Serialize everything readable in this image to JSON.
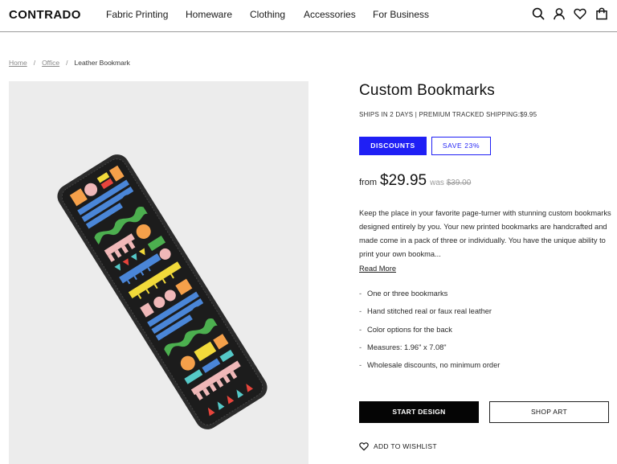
{
  "header": {
    "logo": "CONTRADO",
    "nav": [
      "Fabric Printing",
      "Homeware",
      "Clothing",
      "Accessories",
      "For Business"
    ],
    "icons": [
      "search-icon",
      "user-icon",
      "heart-icon",
      "bag-icon"
    ]
  },
  "breadcrumb": {
    "items": [
      "Home",
      "Office"
    ],
    "current": "Leather Bookmark"
  },
  "product": {
    "title": "Custom Bookmarks",
    "shipping": "SHIPS IN 2 DAYS | PREMIUM TRACKED SHIPPING:$9.95",
    "discounts_label": "DISCOUNTS",
    "save_label": "SAVE 23%",
    "price_from": "from",
    "price": "$29.95",
    "was_label": "was",
    "was_price": "$39.00",
    "description": "Keep the place in your favorite page-turner with stunning custom bookmarks designed entirely by you. Your new printed bookmarks are handcrafted and made come in a pack of three or individually. You have the unique ability to print your own bookma...",
    "read_more": "Read More",
    "features": [
      "One or three bookmarks",
      "Hand stitched real or faux real leather",
      "Color options for the back",
      "Measures: 1.96\" x 7.08\"",
      "Wholesale discounts, no minimum order"
    ],
    "start_design": "START DESIGN",
    "shop_art": "SHOP ART",
    "wishlist": "ADD TO WISHLIST"
  },
  "colors": {
    "accent": "#1f1ff5",
    "bookmark_body": "#1c1c1c",
    "pattern_blue": "#4a86d8",
    "pattern_yellow": "#f2da3a",
    "pattern_green": "#4caf4f",
    "pattern_orange": "#f5a04a",
    "pattern_pink": "#f0b8b8",
    "pattern_red": "#e8453c",
    "pattern_teal": "#55c9c8"
  }
}
